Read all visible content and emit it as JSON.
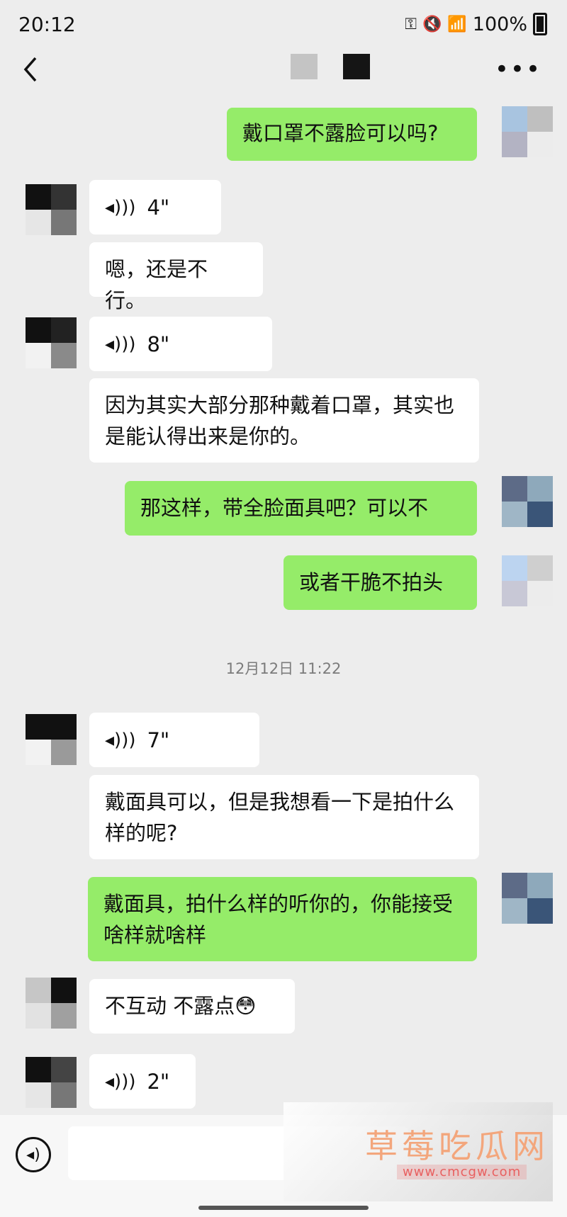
{
  "status": {
    "time": "20:12",
    "battery": "100%"
  },
  "nav": {
    "back_icon": "chevron-left-icon",
    "more_icon": "more-icon"
  },
  "colors": {
    "outgoing": "#95ec69",
    "incoming": "#ffffff",
    "background": "#ededed"
  },
  "messages": {
    "m1": "戴口罩不露脸可以吗?",
    "v1": "4\"",
    "m2": "嗯，还是不行。",
    "v2": "8\"",
    "m3": "因为其实大部分那种戴着口罩，其实也是能认得出来是你的。",
    "m4": "那这样，带全脸面具吧？可以不",
    "m5": "或者干脆不拍头",
    "v3": "7\"",
    "m6": "戴面具可以，但是我想看一下是拍什么样的呢?",
    "m7": "戴面具，拍什么样的听你的，你能接受啥样就啥样",
    "m8": "不互动 不露点😳",
    "v4": "2\""
  },
  "timestamp": "12月12日 11:22",
  "watermark": {
    "text": "草莓吃瓜网",
    "url": "www.cmcgw.com"
  }
}
